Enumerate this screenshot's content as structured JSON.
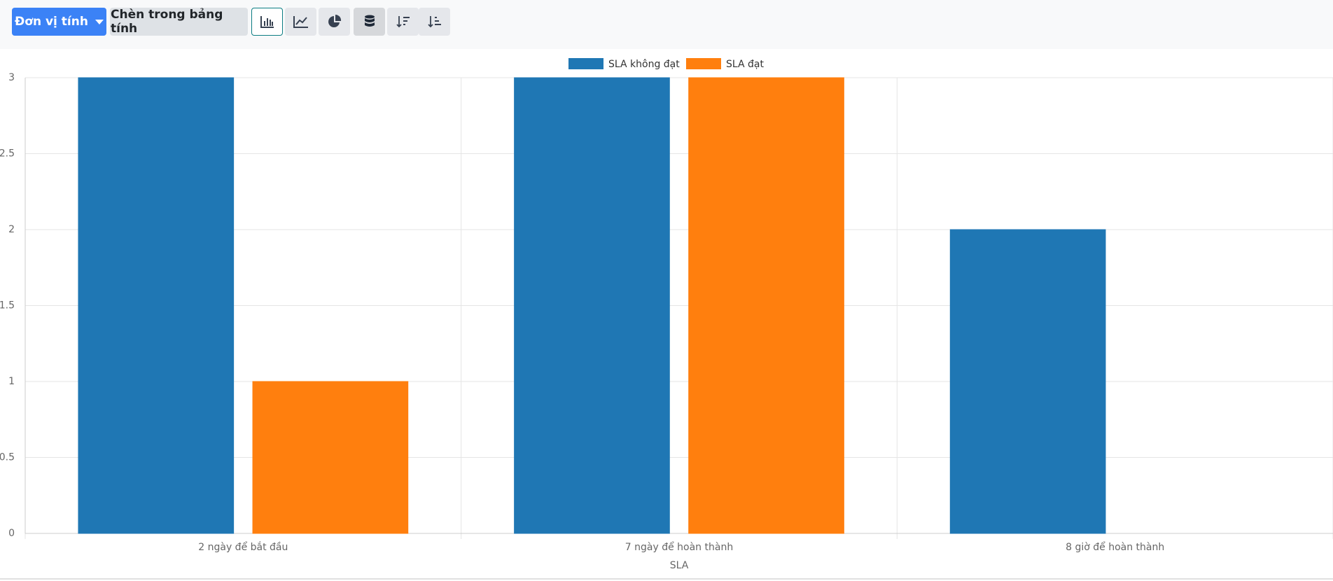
{
  "toolbar": {
    "measure_label": "Đơn vị tính",
    "insert_label": "Chèn trong bảng tính",
    "icons": [
      "bar-chart-icon",
      "line-chart-icon",
      "pie-chart-icon",
      "database-stack-icon",
      "sort-descending-icon",
      "sort-ascending-icon"
    ]
  },
  "colors": {
    "primary": "#3b82f6",
    "series1": "#1f77b4",
    "series2": "#ff7f0e"
  },
  "chart_data": {
    "type": "bar",
    "categories": [
      "2 ngày để bắt đầu",
      "7 ngày để hoàn thành",
      "8 giờ để hoàn thành"
    ],
    "series": [
      {
        "name": "SLA không đạt",
        "values": [
          3,
          3,
          2
        ],
        "color": "#1f77b4"
      },
      {
        "name": "SLA đạt",
        "values": [
          1,
          3,
          0
        ],
        "color": "#ff7f0e"
      }
    ],
    "xlabel": "SLA",
    "ylabel": "",
    "ylim": [
      0,
      3
    ],
    "yticks": [
      "0",
      "0.5",
      "1",
      "1.5",
      "2",
      "2.5",
      "3"
    ],
    "grid": true,
    "legend": "top-center"
  }
}
